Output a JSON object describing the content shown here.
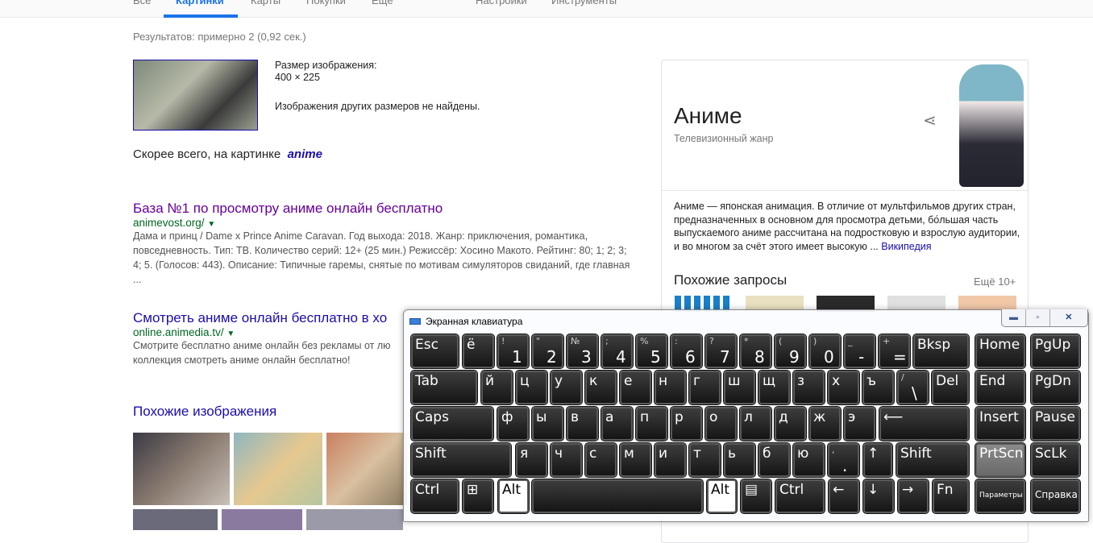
{
  "tabs": [
    "Все",
    "Картинки",
    "Карты",
    "Покупки",
    "Ещё",
    "Настройки",
    "Инструменты"
  ],
  "stats": "Результатов: примерно 2 (0,92 сек.)",
  "image_info": {
    "size_label": "Размер изображения:",
    "size": "400 × 225",
    "other": "Изображения других размеров не найдены."
  },
  "guess": {
    "prefix": "Скорее всего, на картинке",
    "term": "anime"
  },
  "results": [
    {
      "title": "База №1 по просмотру аниме онлайн бесплатно",
      "url": "animevost.org/",
      "snippet": "Дама и принц / Dame x Prince Anime Caravan. Год выхода: 2018. Жанр: приключения, романтика, повседневность. Тип: ТВ. Количество серий: 12+ (25 мин.) Режиссёр: Хосино Макото. Рейтинг: 80; 1; 2; 3; 4; 5. (Голосов: 443). Описание: Типичные гаремы, снятые по мотивам симуляторов свиданий, где главная ..."
    },
    {
      "title": "Смотреть аниме онлайн бесплатно в хо",
      "url": "online.animedia.tv/",
      "snippet": "Смотрите бесплатно аниме онлайн без рекламы от лю коллекция смотреть аниме онлайн бесплатно!"
    }
  ],
  "similar_title": "Похожие изображения",
  "knowledge": {
    "title": "Аниме",
    "subtitle": "Телевизионный жанр",
    "description": "Аниме — японская анимация. В отличие от мультфильмов других стран, предназначенных в основном для просмотра детьми, бо́льшая часть выпускаемого аниме рассчитана на подростковую и взрослую аудитории, и во многом за счёт этого имеет высокую ...",
    "source": "Википедия",
    "related": "Похожие запросы",
    "more": "Ещё 10+"
  },
  "osk": {
    "title": "Экранная клавиатура",
    "controls": [
      "▬",
      "▫",
      "✕"
    ],
    "rows": [
      [
        [
          "Esc"
        ],
        [
          "ё"
        ],
        [
          "1",
          "!"
        ],
        [
          "2",
          "\""
        ],
        [
          "3",
          "№"
        ],
        [
          "4",
          ";"
        ],
        [
          "5",
          "%"
        ],
        [
          "6",
          ":"
        ],
        [
          "7",
          "?"
        ],
        [
          "8",
          "*"
        ],
        [
          "9",
          "("
        ],
        [
          "0",
          ")"
        ],
        [
          "-",
          "_"
        ],
        [
          "=",
          "+"
        ],
        [
          "Bksp"
        ],
        [
          "Home"
        ],
        [
          "PgUp"
        ]
      ],
      [
        [
          "Tab"
        ],
        [
          "й"
        ],
        [
          "ц"
        ],
        [
          "у"
        ],
        [
          "к"
        ],
        [
          "е"
        ],
        [
          "н"
        ],
        [
          "г"
        ],
        [
          "ш"
        ],
        [
          "щ"
        ],
        [
          "з"
        ],
        [
          "х"
        ],
        [
          "ъ"
        ],
        [
          "\\",
          "/"
        ],
        [
          "Del"
        ],
        [
          "End"
        ],
        [
          "PgDn"
        ]
      ],
      [
        [
          "Caps"
        ],
        [
          "ф"
        ],
        [
          "ы"
        ],
        [
          "в"
        ],
        [
          "а"
        ],
        [
          "п"
        ],
        [
          "р"
        ],
        [
          "о"
        ],
        [
          "л"
        ],
        [
          "д"
        ],
        [
          "ж"
        ],
        [
          "э"
        ],
        [
          "⟵"
        ],
        [
          "Insert"
        ],
        [
          "Pause"
        ]
      ],
      [
        [
          "Shift"
        ],
        [
          "я"
        ],
        [
          "ч"
        ],
        [
          "с"
        ],
        [
          "м"
        ],
        [
          "и"
        ],
        [
          "т"
        ],
        [
          "ь"
        ],
        [
          "б"
        ],
        [
          "ю"
        ],
        [
          ".",
          ","
        ],
        [
          "↑"
        ],
        [
          "Shift"
        ],
        [
          "PrtScn"
        ],
        [
          "ScLk"
        ]
      ],
      [
        [
          "Ctrl"
        ],
        [
          "⊞"
        ],
        [
          "Alt"
        ],
        [
          ""
        ],
        [
          "Alt"
        ],
        [
          "▤"
        ],
        [
          "Ctrl"
        ],
        [
          "←"
        ],
        [
          "↓"
        ],
        [
          "→"
        ],
        [
          "Fn"
        ],
        [
          "Параметры"
        ],
        [
          "Справка"
        ]
      ]
    ]
  }
}
